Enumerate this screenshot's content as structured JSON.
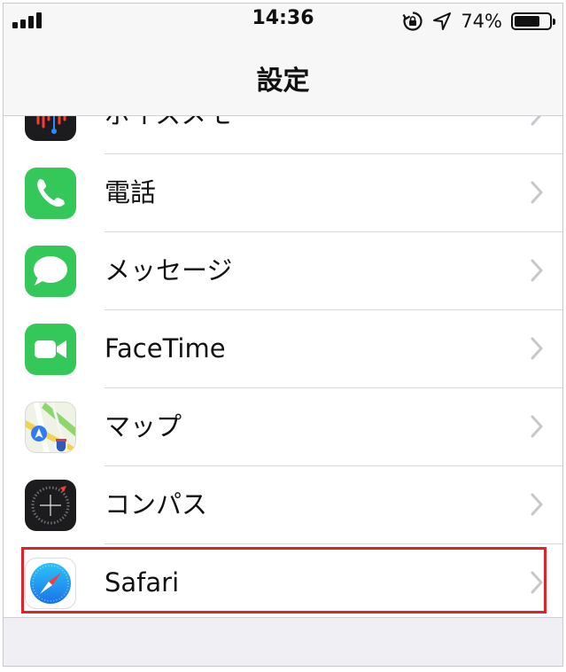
{
  "status_bar": {
    "time": "14:36",
    "battery_percent": "74%",
    "battery_level": 0.74
  },
  "nav": {
    "title": "設定"
  },
  "rows": [
    {
      "label": "ボイスメモ",
      "icon": "voice-memo-icon"
    },
    {
      "label": "電話",
      "icon": "phone-icon"
    },
    {
      "label": "メッセージ",
      "icon": "messages-icon"
    },
    {
      "label": "FaceTime",
      "icon": "facetime-icon"
    },
    {
      "label": "マップ",
      "icon": "maps-icon"
    },
    {
      "label": "コンパス",
      "icon": "compass-icon"
    },
    {
      "label": "Safari",
      "icon": "safari-icon"
    }
  ],
  "colors": {
    "green": "#34c759",
    "highlight": "#e0222a",
    "safari_blue": "#1a8cf0"
  }
}
